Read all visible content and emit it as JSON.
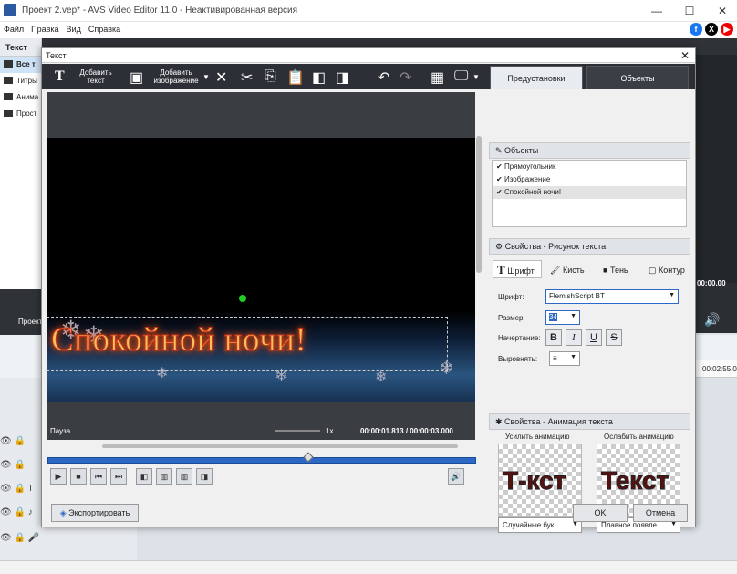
{
  "window": {
    "title": "Проект 2.vep* - AVS Video Editor 11.0 - Неактивированная версия"
  },
  "menu": [
    "Файл",
    "Правка",
    "Вид",
    "Справка"
  ],
  "left_panel": {
    "header": "Текст",
    "items": [
      "Все т",
      "Титры",
      "Анима",
      "Прост"
    ]
  },
  "main": {
    "project_label": "Проект",
    "timecode": "00:00.00",
    "timeline_time": "00:02:55.0"
  },
  "dialog": {
    "title": "Текст",
    "toolbar": {
      "add_text": "Добавить текст",
      "add_image": "Добавить изображение"
    },
    "tabs": {
      "presets": "Предустановки",
      "objects": "Объекты"
    },
    "preview": {
      "text": "Спокойной ночи!",
      "status": "Пауза",
      "speed": "1x",
      "time": "00:00:01.813 / 00:00:03.000",
      "progress": 0.6
    },
    "objects": {
      "header": "Объекты",
      "items": [
        "Прямоугольник",
        "Изображение",
        "Спокойной ночи!"
      ]
    },
    "props": {
      "header": "Свойства - Рисунок текста",
      "tabs": [
        "Шрифт",
        "Кисть",
        "Тень",
        "Контур"
      ],
      "font_label": "Шрифт:",
      "font_value": "FlemishScript BT",
      "size_label": "Размер:",
      "size_value": "34",
      "style_label": "Начертание:",
      "align_label": "Выровнять:",
      "bold": "B",
      "italic": "I",
      "underline": "U",
      "strike": "S"
    },
    "anim": {
      "header": "Свойства - Анимация текста",
      "in_label": "Усилить анимацию",
      "out_label": "Ослабить анимацию",
      "in_preview": "Т-кст",
      "out_preview": "Текст",
      "in_value": "Случайные бук...",
      "out_value": "Плавное появле..."
    },
    "export": "Экспортировать",
    "ok": "OK",
    "cancel": "Отмена"
  },
  "colors": {
    "accent": "#2d68c4",
    "dark": "#2c3036",
    "text_glow": "#ff5a00"
  }
}
